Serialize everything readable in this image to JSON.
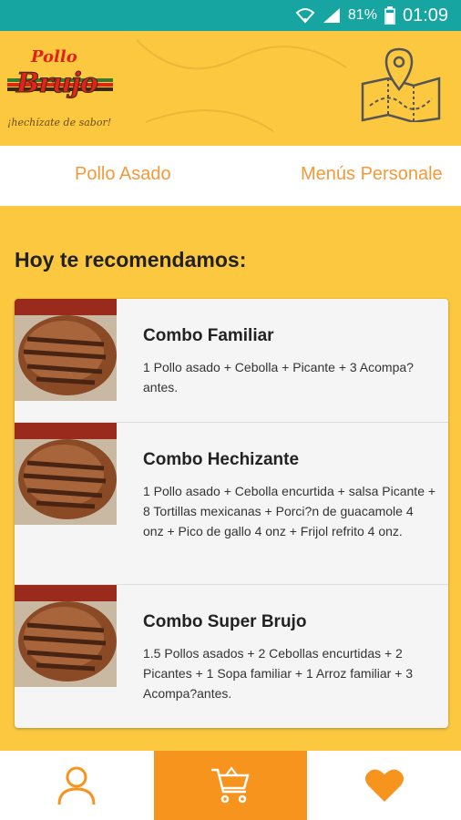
{
  "status_bar": {
    "battery": "81%",
    "time": "01:09"
  },
  "header": {
    "logo": {
      "word1": "Pollo",
      "word2": "Brujo",
      "tagline": "¡hechízate de sabor!"
    },
    "map_icon": "map-pin-icon"
  },
  "tabs": [
    {
      "label": "Pollo Asado"
    },
    {
      "label": "Menús Personale"
    }
  ],
  "main": {
    "section_title": "Hoy te recomendamos:",
    "items": [
      {
        "title": "Combo Familiar",
        "description": "1 Pollo asado + Cebolla + Picante + 3 Acompa?antes."
      },
      {
        "title": "Combo Hechizante",
        "description": "1 Pollo asado + Cebolla encurtida + salsa Picante + 8 Tortillas mexicanas + Porci?n de guacamole 4 onz + Pico de gallo 4 onz + Frijol refrito 4 onz."
      },
      {
        "title": "Combo Super Brujo",
        "description": "1.5 Pollos asados + 2 Cebollas encurtidas + 2 Picantes + 1 Sopa familiar + 1 Arroz familiar + 3 Acompa?antes."
      }
    ]
  },
  "bottom_nav": [
    {
      "icon": "user-icon"
    },
    {
      "icon": "cart-icon",
      "active": true
    },
    {
      "icon": "heart-icon"
    }
  ],
  "colors": {
    "status_bar": "#17a5a2",
    "background": "#fbc83f",
    "accent": "#f7941e",
    "tab_text": "#f29a3a",
    "logo_red": "#e2231a"
  }
}
